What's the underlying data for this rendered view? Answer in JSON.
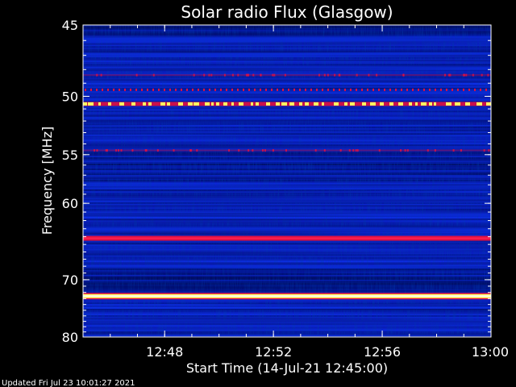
{
  "chart_data": {
    "type": "heatmap",
    "title": "Solar radio Flux (Glasgow)",
    "xlabel": "Start Time (14-Jul-21 12:45:00)",
    "ylabel": "Frequency [MHz]",
    "x_ticks": [
      "12:48",
      "12:52",
      "12:56",
      "13:00"
    ],
    "x_tick_values_minutes": [
      3,
      7,
      11,
      15
    ],
    "xlim_minutes": [
      0,
      15
    ],
    "y_ticks": [
      45,
      50,
      55,
      60,
      70,
      80
    ],
    "ylim": [
      45,
      80
    ],
    "y_scale": "reciprocal",
    "colors": {
      "background": "#000000",
      "spectrogram_base": "#0a1ec8",
      "emission_red": "#e01040",
      "emission_yellow": "#ffff60",
      "emission_white": "#fffff0"
    },
    "emission_bands_mhz": [
      {
        "freq": 48.4,
        "intensity": "low"
      },
      {
        "freq": 49.5,
        "intensity": "medium"
      },
      {
        "freq": 50.6,
        "intensity": "high"
      },
      {
        "freq": 54.6,
        "intensity": "low"
      },
      {
        "freq": 64.2,
        "intensity": "medium"
      },
      {
        "freq": 72.6,
        "intensity": "very-high"
      }
    ],
    "footer": "Updated Fri Jul 23 10:01:27 2021"
  }
}
